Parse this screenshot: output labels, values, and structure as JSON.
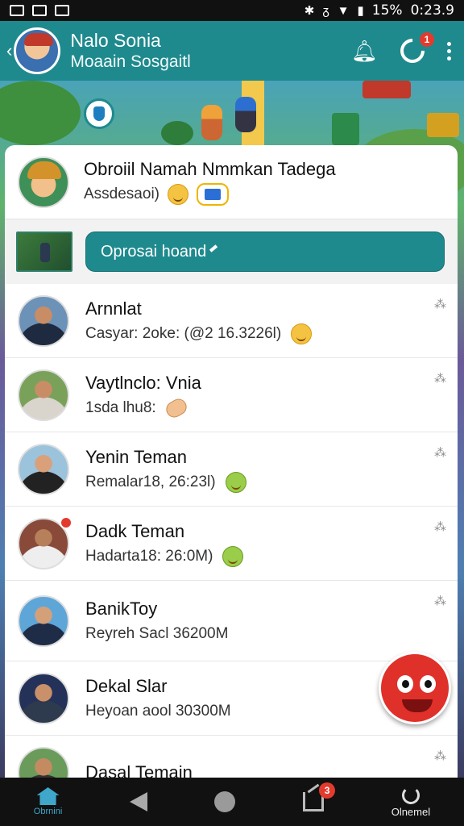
{
  "status_bar": {
    "battery": "15%",
    "time": "0:23.9"
  },
  "header": {
    "title": "Nalo Sonia",
    "subtitle": "Moaain Sosgaitl",
    "notification_badge": "1"
  },
  "profile": {
    "name": "Obroiil Namah Nmmkan Tadega",
    "status": "Assdesaoi)"
  },
  "composer": {
    "placeholder": "Oprosai hoand"
  },
  "chats": [
    {
      "name": "Arnnlat",
      "preview": "Casyar: 2oke: (@2 16.3226l)",
      "pin": "⁂",
      "emoji": "smile"
    },
    {
      "name": "Vaytlnclo: Vnia",
      "preview": "1sda lhu8:",
      "pin": "⁂",
      "emoji": "hand"
    },
    {
      "name": "Yenin Teman",
      "preview": "Remalar18, 26:23l)",
      "pin": "⁂",
      "emoji": "green"
    },
    {
      "name": "Dadk Teman",
      "preview": "Hadarta18: 26:0M)",
      "pin": "⁂",
      "emoji": "green",
      "unread": true
    },
    {
      "name": "BanikToy",
      "preview": "Reyreh Sacl 36200M",
      "pin": "⁂"
    },
    {
      "name": "Dekal Slar",
      "preview": "Heyoan aool 30300M",
      "pin": "⁂"
    },
    {
      "name": "Dasal Temain",
      "preview": "",
      "pin": "⁂"
    }
  ],
  "nav": {
    "home_label": "Obrnini",
    "messages_badge": "3",
    "profile_label": "Olnemel"
  }
}
